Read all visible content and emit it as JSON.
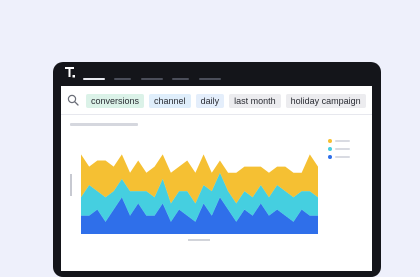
{
  "search": {
    "chips": [
      {
        "label": "conversions",
        "color": "#dbf2e8"
      },
      {
        "label": "channel",
        "color": "#dfeefb"
      },
      {
        "label": "daily",
        "color": "#e4eefb"
      },
      {
        "label": "last month",
        "color": "#ececef"
      },
      {
        "label": "holiday campaign",
        "color": "#ececef"
      }
    ]
  },
  "colors": {
    "series_yellow": "#f5c033",
    "series_teal": "#45cfe0",
    "series_blue": "#2f6fea"
  },
  "chart_data": {
    "type": "area",
    "stacked": true,
    "x": [
      1,
      2,
      3,
      4,
      5,
      6,
      7,
      8,
      9,
      10,
      11,
      12,
      13,
      14,
      15,
      16,
      17,
      18,
      19,
      20,
      21,
      22,
      23,
      24,
      25,
      26,
      27,
      28,
      29,
      30
    ],
    "series": [
      {
        "color": "#2f6fea",
        "values": [
          3,
          3,
          4,
          2,
          4,
          6,
          3,
          5,
          3,
          3,
          5,
          2,
          4,
          3,
          2,
          5,
          3,
          6,
          4,
          2,
          4,
          3,
          5,
          3,
          4,
          3,
          2,
          4,
          3,
          3
        ]
      },
      {
        "color": "#45cfe0",
        "values": [
          3,
          5,
          3,
          4,
          3,
          3,
          4,
          2,
          4,
          3,
          4,
          3,
          3,
          4,
          3,
          3,
          4,
          4,
          3,
          3,
          3,
          3,
          3,
          3,
          4,
          4,
          4,
          3,
          4,
          3
        ]
      },
      {
        "color": "#f5c033",
        "values": [
          7,
          3,
          5,
          6,
          4,
          4,
          3,
          5,
          3,
          5,
          4,
          5,
          4,
          5,
          5,
          5,
          3,
          2,
          3,
          5,
          4,
          5,
          3,
          4,
          3,
          4,
          4,
          3,
          6,
          5
        ]
      }
    ]
  }
}
